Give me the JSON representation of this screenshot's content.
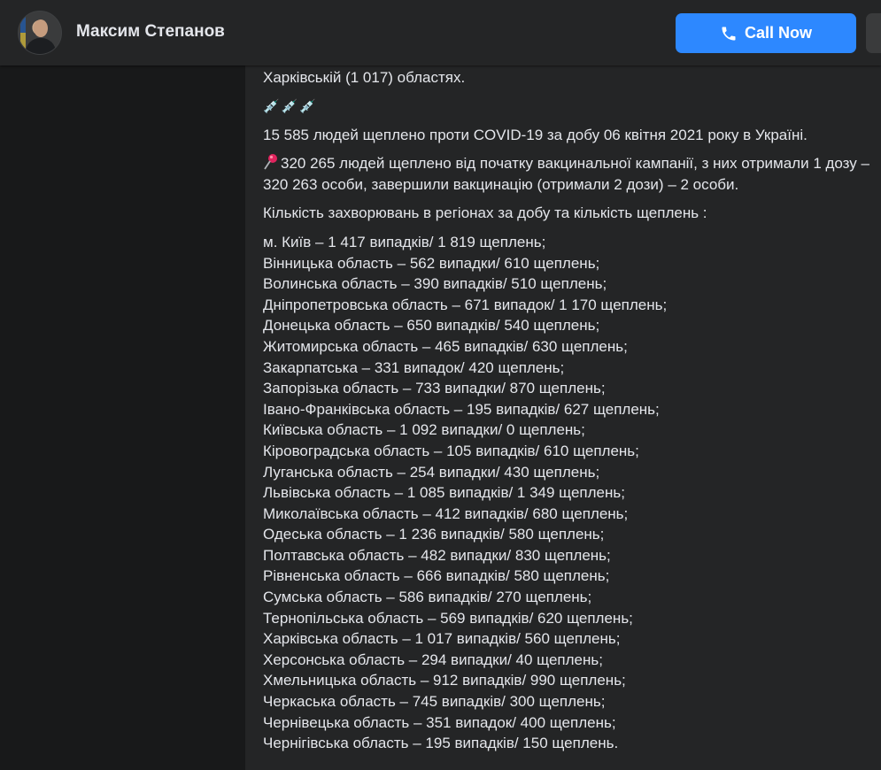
{
  "header": {
    "page_name": "Максим Степанов",
    "call_button_label": "Call Now",
    "icons": {
      "phone": "phone-icon",
      "avatar": "profile-photo"
    },
    "accent_color": "#2d88ff"
  },
  "post": {
    "line_intro": "Харківській (1 017) областях.",
    "syringes": "💉💉💉",
    "vaccinated_day": "15 585 людей щеплено проти COVID-19 за добу 06 квітня 2021 року в Україні.",
    "vaccinated_total": "320 265 людей щеплено від початку вакцинальної кампанії, з них отримали 1 дозу – 320 263 особи, завершили вакцинацію (отримали 2 дози) – 2 особи.",
    "regions_heading": "Кількість захворювань в регіонах за добу та кількість щеплень :",
    "regions": [
      "м. Київ – 1 417 випадків/ 1 819 щеплень;",
      "Вінницька область – 562 випадки/ 610 щеплень;",
      "Волинська область – 390 випадків/ 510 щеплень;",
      "Дніпропетровська область – 671 випадок/ 1 170 щеплень;",
      "Донецька область – 650 випадків/ 540 щеплень;",
      "Житомирська область – 465 випадків/ 630 щеплень;",
      "Закарпатська – 331 випадок/ 420 щеплень;",
      "Запорізька область – 733 випадки/ 870 щеплень;",
      "Івано-Франківська область – 195 випадків/ 627 щеплень;",
      "Київська область – 1 092 випадки/ 0 щеплень;",
      "Кіровоградська область – 105 випадків/ 610 щеплень;",
      "Луганська область – 254 випадки/ 430 щеплень;",
      "Львівська область – 1 085 випадків/ 1 349 щеплень;",
      "Миколаївська область – 412 випадків/ 680 щеплень;",
      "Одеська область – 1 236 випадків/ 580 щеплень;",
      "Полтавська область – 482 випадки/ 830 щеплень;",
      "Рівненська область – 666 випадків/ 580 щеплень;",
      "Сумська область – 586 випадків/ 270 щеплень;",
      "Тернопільська область – 569 випадків/ 620 щеплень;",
      "Харківська область – 1 017 випадків/ 560 щеплень;",
      "Херсонська область – 294 випадки/ 40 щеплень;",
      "Хмельницька область – 912 випадків/ 990 щеплень;",
      "Черкаська область – 745 випадків/ 300 щеплень;",
      "Чернівецька область – 351 випадок/ 400 щеплень;",
      "Чернігівська область – 195 випадків/ 150 щеплень."
    ]
  }
}
